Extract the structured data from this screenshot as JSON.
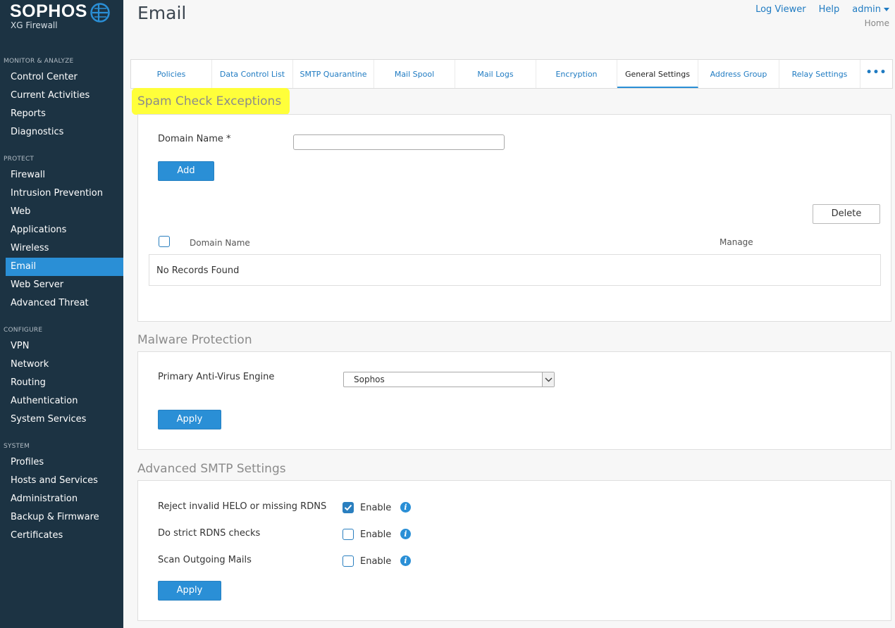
{
  "brand": {
    "name": "SOPHOS",
    "product": "XG Firewall",
    "colors": {
      "sidebar": "#1c3343",
      "accent": "#2a8fd6",
      "link": "#1f7bc2",
      "highlight": "#ffff3a"
    }
  },
  "header": {
    "title": "Email",
    "links": {
      "log_viewer": "Log Viewer",
      "help": "Help",
      "admin": "admin"
    },
    "breadcrumb": "Home"
  },
  "sidebar": {
    "sections": {
      "monitor": "MONITOR & ANALYZE",
      "protect": "PROTECT",
      "configure": "CONFIGURE",
      "system": "SYSTEM"
    },
    "items": [
      {
        "label": "Control Center"
      },
      {
        "label": "Current Activities"
      },
      {
        "label": "Reports"
      },
      {
        "label": "Diagnostics"
      },
      {
        "label": "Firewall"
      },
      {
        "label": "Intrusion Prevention"
      },
      {
        "label": "Web"
      },
      {
        "label": "Applications"
      },
      {
        "label": "Wireless"
      },
      {
        "label": "Email"
      },
      {
        "label": "Web Server"
      },
      {
        "label": "Advanced Threat"
      },
      {
        "label": "VPN"
      },
      {
        "label": "Network"
      },
      {
        "label": "Routing"
      },
      {
        "label": "Authentication"
      },
      {
        "label": "System Services"
      },
      {
        "label": "Profiles"
      },
      {
        "label": "Hosts and Services"
      },
      {
        "label": "Administration"
      },
      {
        "label": "Backup & Firmware"
      },
      {
        "label": "Certificates"
      }
    ],
    "active_item": "Email"
  },
  "tabs": [
    {
      "label": "Policies"
    },
    {
      "label": "Data Control List"
    },
    {
      "label": "SMTP Quarantine"
    },
    {
      "label": "Mail Spool"
    },
    {
      "label": "Mail Logs"
    },
    {
      "label": "Encryption"
    },
    {
      "label": "General Settings"
    },
    {
      "label": "Address Group"
    },
    {
      "label": "Relay Settings"
    }
  ],
  "tabs_more": "•••",
  "active_tab": "General Settings",
  "spam_check": {
    "heading": "Spam Check Exceptions",
    "domain_label": "Domain Name *",
    "domain_value": "",
    "add_label": "Add",
    "delete_label": "Delete",
    "col_domain": "Domain Name",
    "col_manage": "Manage",
    "empty_text": "No Records Found"
  },
  "malware": {
    "heading": "Malware Protection",
    "engine_label": "Primary Anti-Virus Engine",
    "engine_value": "Sophos",
    "apply_label": "Apply"
  },
  "smtp": {
    "heading": "Advanced SMTP Settings",
    "rows": [
      {
        "label": "Reject invalid HELO or missing RDNS",
        "checked": true,
        "enable": "Enable"
      },
      {
        "label": "Do strict RDNS checks",
        "checked": false,
        "enable": "Enable"
      },
      {
        "label": "Scan Outgoing Mails",
        "checked": false,
        "enable": "Enable"
      }
    ],
    "apply_label": "Apply"
  }
}
